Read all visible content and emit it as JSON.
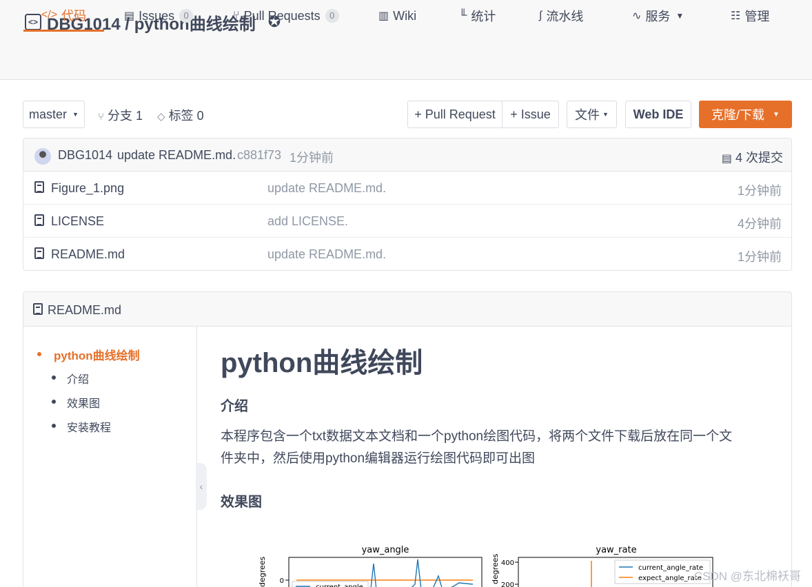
{
  "repo": {
    "title": "DBG1014 / python曲线绘制",
    "icon": "code-box-icon",
    "badge_icon": "award-badge-icon"
  },
  "tabs": [
    {
      "label": "代码",
      "icon": "code-icon"
    },
    {
      "label": "Issues",
      "count": "0",
      "icon": "issues-icon"
    },
    {
      "label": "Pull Requests",
      "count": "0",
      "icon": "pull-request-icon"
    },
    {
      "label": "Wiki",
      "icon": "wiki-icon"
    },
    {
      "label": "统计",
      "icon": "chart-icon"
    },
    {
      "label": "流水线",
      "icon": "pipeline-icon"
    },
    {
      "label": "服务",
      "icon": "pulse-icon"
    },
    {
      "label": "管理",
      "icon": "manage-icon"
    }
  ],
  "toolbar": {
    "branch": "master",
    "branches": "分支 1",
    "tags": "标签 0",
    "pull_request": "+ Pull Request",
    "issue": "+ Issue",
    "file": "文件",
    "web_ide": "Web IDE",
    "clone": "克隆/下载"
  },
  "commit": {
    "author": "DBG1014",
    "message": "update README.md.",
    "hash": "c881f73",
    "time": "1分钟前",
    "total": "4 次提交"
  },
  "files": [
    {
      "name": "Figure_1.png",
      "message": "update README.md.",
      "time": "1分钟前"
    },
    {
      "name": "LICENSE",
      "message": "add LICENSE.",
      "time": "4分钟前"
    },
    {
      "name": "README.md",
      "message": "update README.md.",
      "time": "1分钟前"
    }
  ],
  "readme": {
    "title": "README.md",
    "toc": {
      "main": "python曲线绘制",
      "items": [
        "介绍",
        "效果图",
        "安装教程"
      ]
    },
    "h1": "python曲线绘制",
    "h_intro": "介绍",
    "intro_line1": "本程序包含一个txt数据文本文档和一个python绘图代码，将两个文件下载后放在同一个文",
    "intro_line2": "件夹中，然后使用python编辑器运行绘图代码即可出图",
    "h_effect": "效果图"
  },
  "figure": {
    "left_title": "yaw_angle",
    "right_title": "yaw_rate",
    "ylabel": "degrees",
    "left_tick": "0",
    "right_ticks": [
      "400",
      "200"
    ],
    "legend_left": "current_angle",
    "legend_right": [
      "current_angle_rate",
      "expect_angle_rate"
    ],
    "colors": {
      "blue": "#1f77b4",
      "orange": "#ff7f0e"
    }
  },
  "watermark": "CSDN @东北棉袄哥",
  "colors": {
    "accent": "#e6702a",
    "text": "#40485b",
    "muted": "#9098a5"
  }
}
